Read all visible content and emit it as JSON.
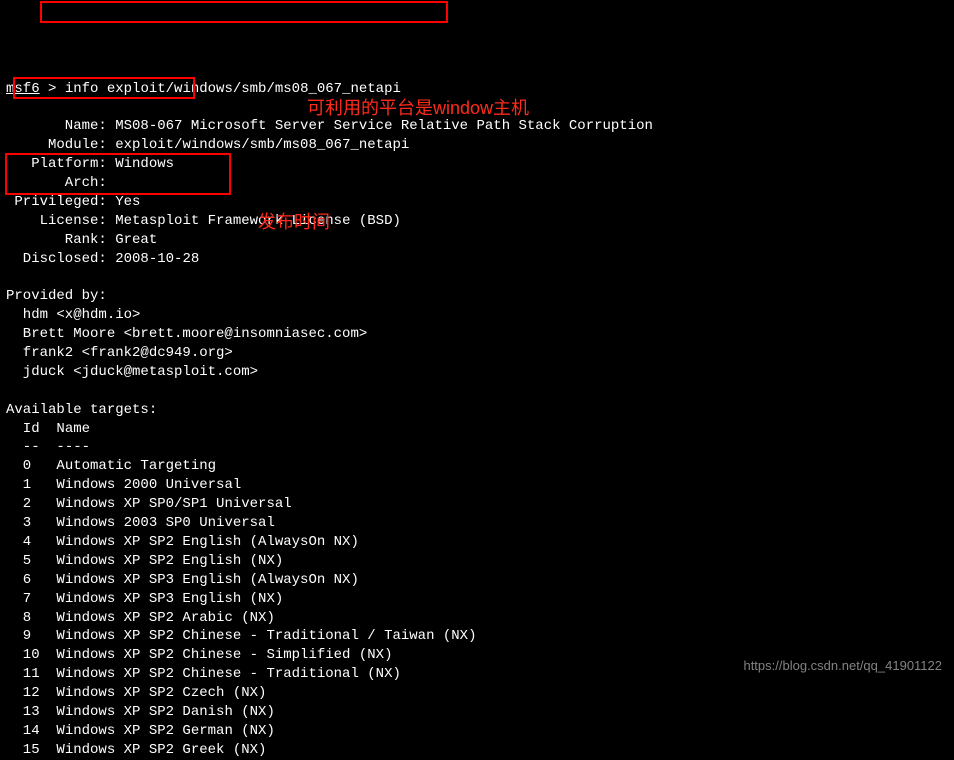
{
  "prompt": {
    "label": "msf6",
    "symbol": " > ",
    "command": "info exploit/windows/smb/ms08_067_netapi"
  },
  "info": {
    "name_label": "       Name:",
    "name_value": " MS08-067 Microsoft Server Service Relative Path Stack Corruption",
    "module_label": "     Module:",
    "module_value": " exploit/windows/smb/ms08_067_netapi",
    "platform_label": "   Platform:",
    "platform_value": " Windows",
    "arch_label": "       Arch:",
    "arch_value": " ",
    "privileged_label": " Privileged:",
    "privileged_value": " Yes",
    "license_label": "    License:",
    "license_value": " Metasploit Framework License (BSD)",
    "rank_label": "       Rank:",
    "rank_value": " Great",
    "disclosed_label": "  Disclosed:",
    "disclosed_value": " 2008-10-28"
  },
  "provided_by": {
    "header": "Provided by:",
    "authors": [
      "  hdm <x@hdm.io>",
      "  Brett Moore <brett.moore@insomniasec.com>",
      "  frank2 <frank2@dc949.org>",
      "  jduck <jduck@metasploit.com>"
    ]
  },
  "targets": {
    "header": "Available targets:",
    "col_id": "  Id",
    "col_name": "  Name",
    "sep_id": "  --",
    "sep_name": "  ----",
    "rows": [
      {
        "id": "  0 ",
        "name": "  Automatic Targeting"
      },
      {
        "id": "  1 ",
        "name": "  Windows 2000 Universal"
      },
      {
        "id": "  2 ",
        "name": "  Windows XP SP0/SP1 Universal"
      },
      {
        "id": "  3 ",
        "name": "  Windows 2003 SP0 Universal"
      },
      {
        "id": "  4 ",
        "name": "  Windows XP SP2 English (AlwaysOn NX)"
      },
      {
        "id": "  5 ",
        "name": "  Windows XP SP2 English (NX)"
      },
      {
        "id": "  6 ",
        "name": "  Windows XP SP3 English (AlwaysOn NX)"
      },
      {
        "id": "  7 ",
        "name": "  Windows XP SP3 English (NX)"
      },
      {
        "id": "  8 ",
        "name": "  Windows XP SP2 Arabic (NX)"
      },
      {
        "id": "  9 ",
        "name": "  Windows XP SP2 Chinese - Traditional / Taiwan (NX)"
      },
      {
        "id": "  10",
        "name": "  Windows XP SP2 Chinese - Simplified (NX)"
      },
      {
        "id": "  11",
        "name": "  Windows XP SP2 Chinese - Traditional (NX)"
      },
      {
        "id": "  12",
        "name": "  Windows XP SP2 Czech (NX)"
      },
      {
        "id": "  13",
        "name": "  Windows XP SP2 Danish (NX)"
      },
      {
        "id": "  14",
        "name": "  Windows XP SP2 German (NX)"
      },
      {
        "id": "  15",
        "name": "  Windows XP SP2 Greek (NX)"
      }
    ]
  },
  "annotations": {
    "platform_note": "可利用的平台是window主机",
    "disclosed_note": "发布时间"
  },
  "watermark": "https://blog.csdn.net/qq_41901122"
}
